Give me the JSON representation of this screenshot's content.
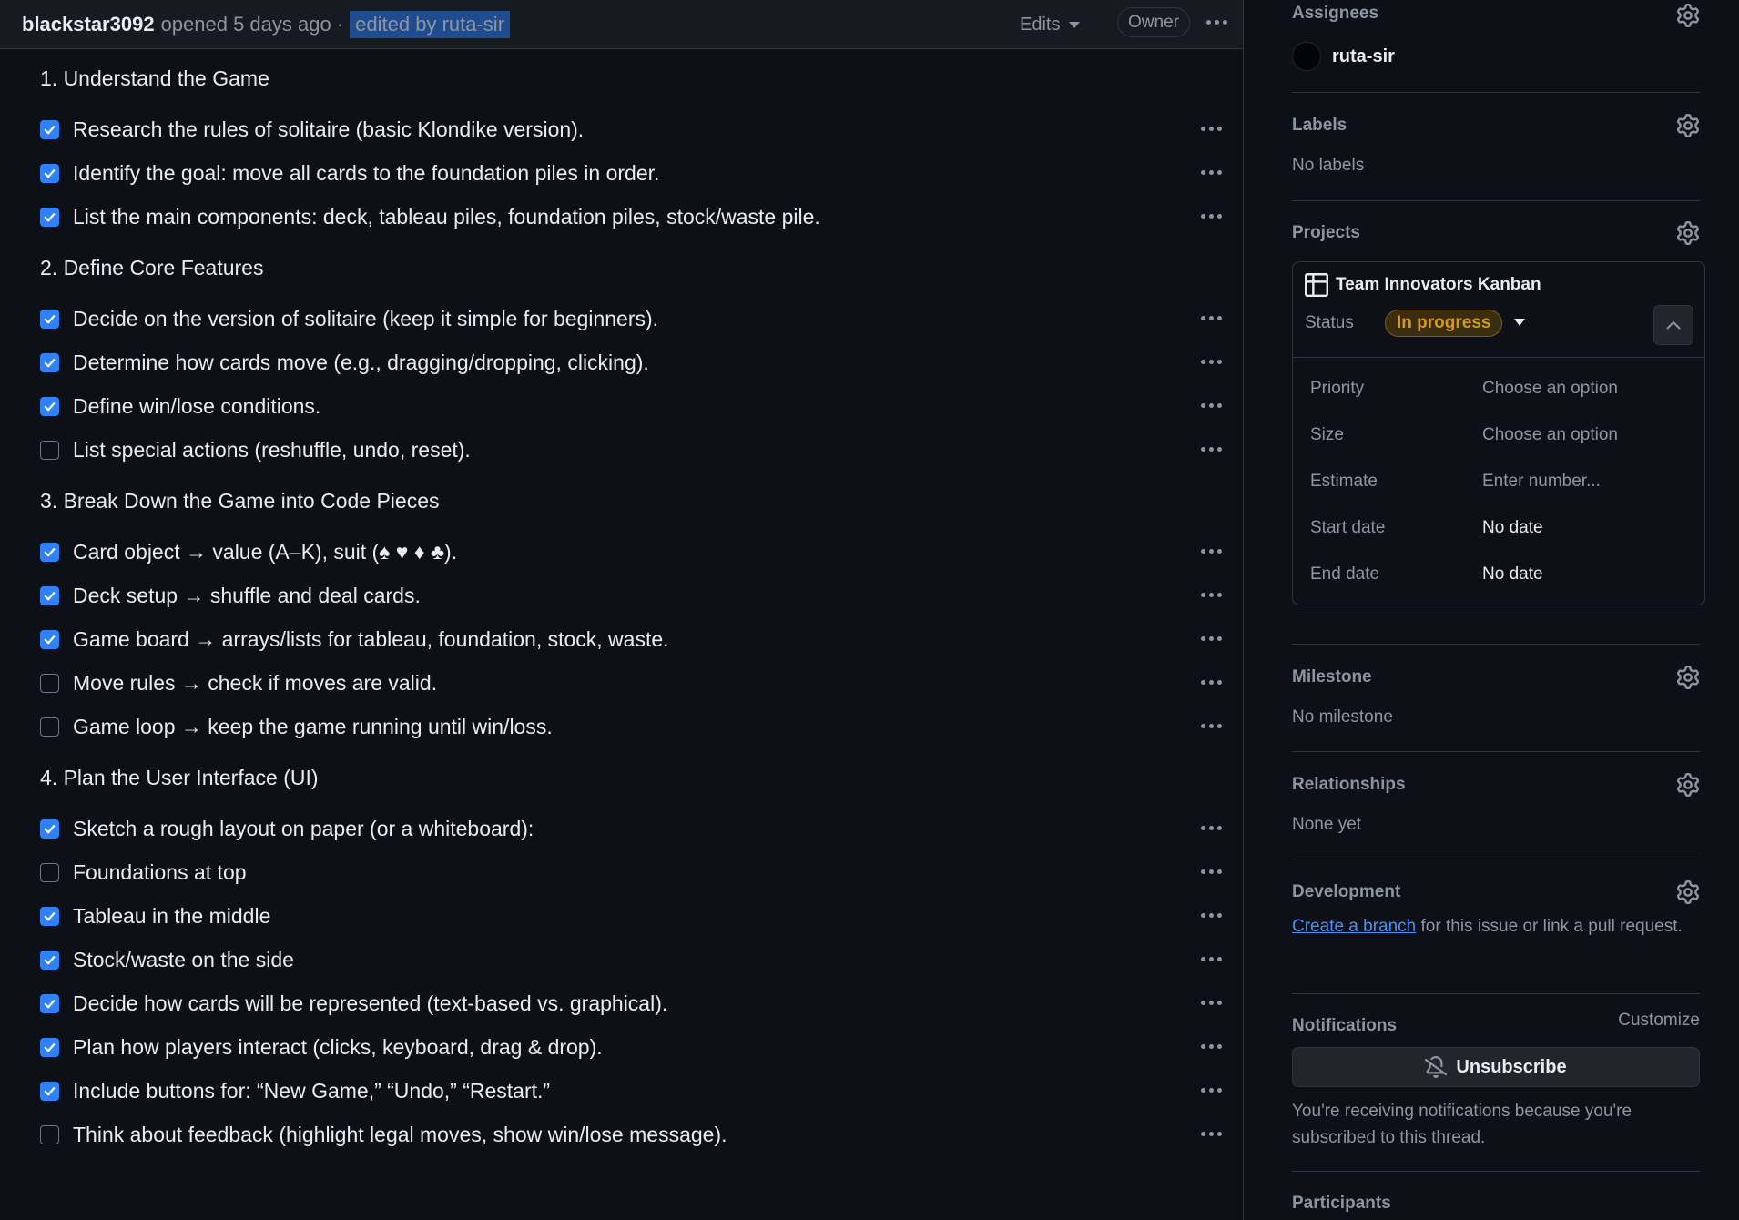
{
  "header": {
    "author": "blackstar3092",
    "meta": "opened 5 days ago ·",
    "edited": "edited by ruta-sir",
    "edits_label": "Edits",
    "owner_badge": "Owner"
  },
  "sections": [
    {
      "heading": "1. Understand the Game",
      "tasks": [
        {
          "text": "Research the rules of solitaire (basic Klondike version).",
          "checked": true
        },
        {
          "text": "Identify the goal: move all cards to the foundation piles in order.",
          "checked": true
        },
        {
          "text": "List the main components: deck, tableau piles, foundation piles, stock/waste pile.",
          "checked": true
        }
      ]
    },
    {
      "heading": "2. Define Core Features",
      "tasks": [
        {
          "text": "Decide on the version of solitaire (keep it simple for beginners).",
          "checked": true
        },
        {
          "text": "Determine how cards move (e.g., dragging/dropping, clicking).",
          "checked": true
        },
        {
          "text": "Define win/lose conditions.",
          "checked": true
        },
        {
          "text": "List special actions (reshuffle, undo, reset).",
          "checked": false
        }
      ]
    },
    {
      "heading": "3. Break Down the Game into Code Pieces",
      "tasks": [
        {
          "text": "Card object → value (A–K), suit (♠ ♥ ♦ ♣).",
          "checked": true
        },
        {
          "text": "Deck setup → shuffle and deal cards.",
          "checked": true
        },
        {
          "text": "Game board → arrays/lists for tableau, foundation, stock, waste.",
          "checked": true
        },
        {
          "text": "Move rules → check if moves are valid.",
          "checked": false
        },
        {
          "text": "Game loop → keep the game running until win/loss.",
          "checked": false
        }
      ]
    },
    {
      "heading": "4. Plan the User Interface (UI)",
      "tasks": [
        {
          "text": "Sketch a rough layout on paper (or a whiteboard):",
          "checked": true
        },
        {
          "text": "Foundations at top",
          "checked": false
        },
        {
          "text": "Tableau in the middle",
          "checked": true
        },
        {
          "text": "Stock/waste on the side",
          "checked": true
        },
        {
          "text": "Decide how cards will be represented (text-based vs. graphical).",
          "checked": true
        },
        {
          "text": "Plan how players interact (clicks, keyboard, drag & drop).",
          "checked": true
        },
        {
          "text": "Include buttons for: “New Game,” “Undo,” “Restart.”",
          "checked": true
        },
        {
          "text": "Think about feedback (highlight legal moves, show win/lose message).",
          "checked": false
        }
      ]
    }
  ],
  "sidebar": {
    "assignees": {
      "title": "Assignees",
      "name": "ruta-sir"
    },
    "labels": {
      "title": "Labels",
      "value": "No labels"
    },
    "projects": {
      "title": "Projects",
      "project_name": "Team Innovators Kanban",
      "status_label": "Status",
      "status_value": "In progress",
      "fields": [
        {
          "label": "Priority",
          "value": "Choose an option"
        },
        {
          "label": "Size",
          "value": "Choose an option"
        },
        {
          "label": "Estimate",
          "value": "Enter number..."
        },
        {
          "label": "Start date",
          "value": "No date"
        },
        {
          "label": "End date",
          "value": "No date"
        }
      ]
    },
    "milestone": {
      "title": "Milestone",
      "value": "No milestone"
    },
    "relationships": {
      "title": "Relationships",
      "value": "None yet"
    },
    "development": {
      "title": "Development",
      "link": "Create a branch",
      "text": " for this issue or link a pull request."
    },
    "notifications": {
      "title": "Notifications",
      "customize": "Customize",
      "button": "Unsubscribe",
      "text": "You're receiving notifications because you're subscribed to this thread."
    },
    "participants": {
      "title": "Participants"
    }
  },
  "colors": {
    "background": "#0d1117",
    "accent": "#2f81f7",
    "status_in_progress": "#d29922",
    "link": "#4493f8"
  },
  "icons": {
    "gear": "gear-icon",
    "checkbox": "checkbox-check-icon",
    "kebab": "kebab-horizontal-icon",
    "table": "table-icon",
    "bell_slash": "bell-slash-icon",
    "chevron_up": "chevron-up-icon",
    "triangle_down": "triangle-down-icon"
  }
}
